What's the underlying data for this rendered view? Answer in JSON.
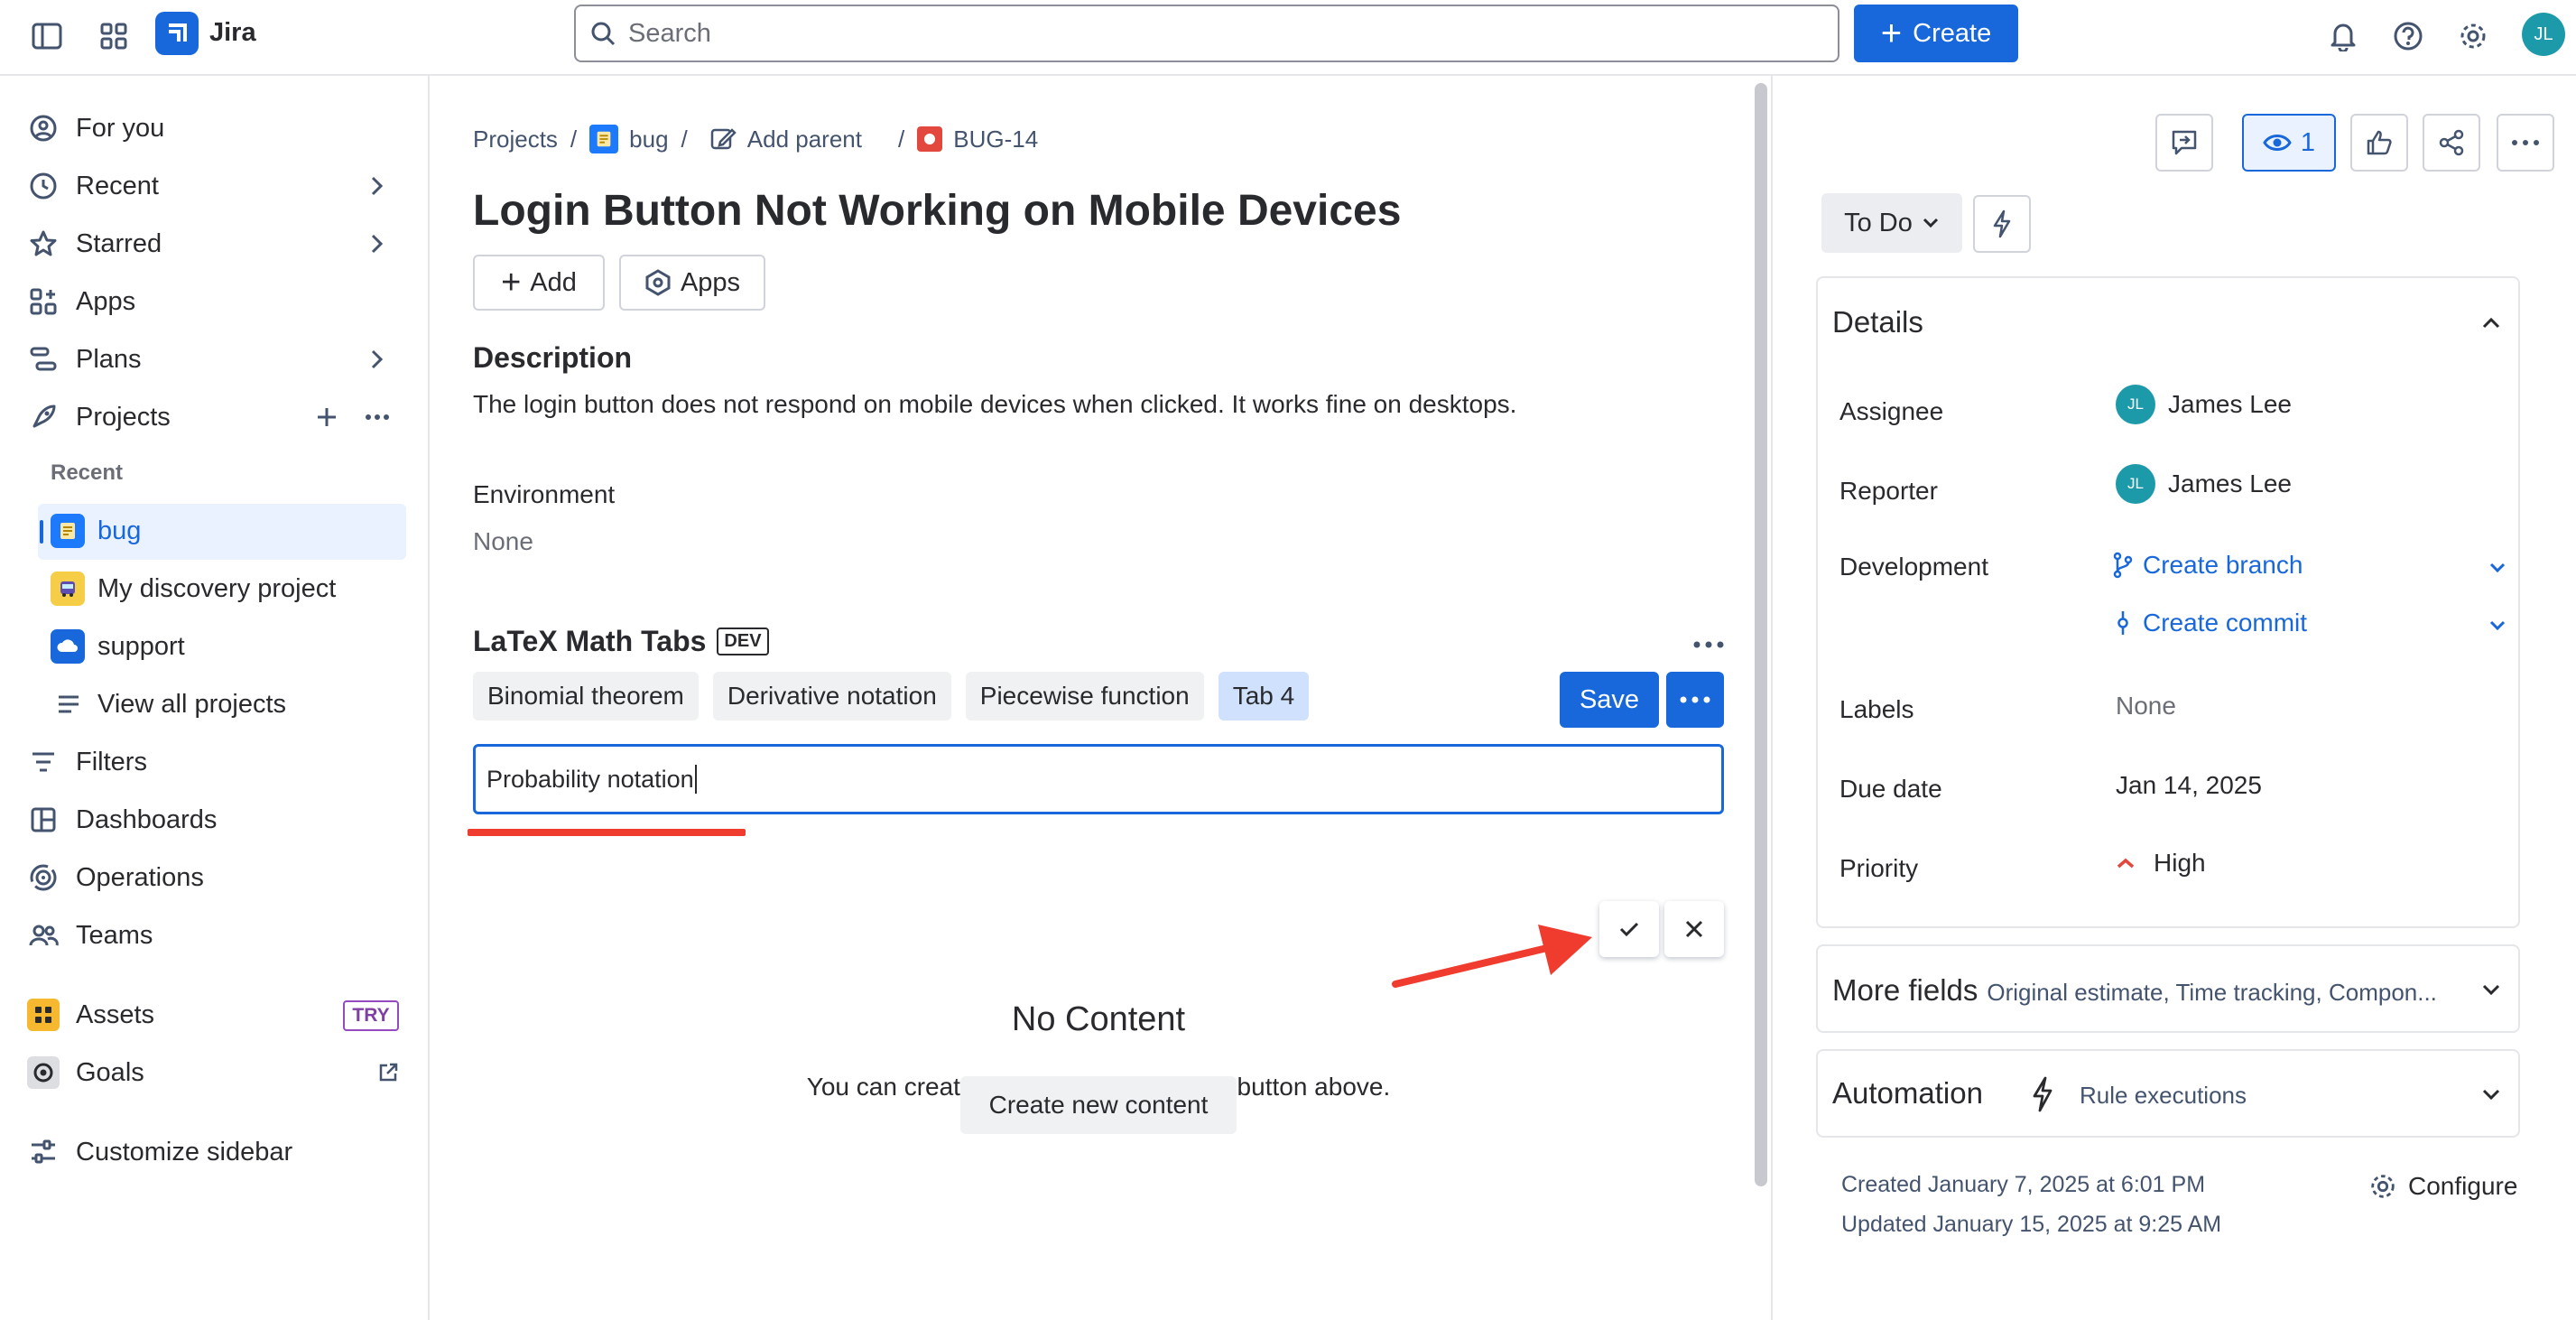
{
  "topbar": {
    "app_name": "Jira",
    "search_placeholder": "Search",
    "create_label": "Create",
    "avatar_initials": "JL"
  },
  "sidebar": {
    "items": [
      {
        "label": "For you",
        "icon": "user-circle-icon"
      },
      {
        "label": "Recent",
        "icon": "clock-icon"
      },
      {
        "label": "Starred",
        "icon": "star-icon"
      },
      {
        "label": "Apps",
        "icon": "apps-icon"
      },
      {
        "label": "Plans",
        "icon": "plans-icon"
      },
      {
        "label": "Projects",
        "icon": "rocket-icon"
      }
    ],
    "recent_heading": "Recent",
    "projects": [
      {
        "label": "bug",
        "icon": "notepad-icon",
        "color": "#1d7afc"
      },
      {
        "label": "My discovery project",
        "icon": "bus-icon",
        "color": "#f5cd47"
      },
      {
        "label": "support",
        "icon": "cloud-icon",
        "color": "#1868db"
      }
    ],
    "view_all": "View all projects",
    "bottom_items": [
      {
        "label": "Filters",
        "icon": "filter-icon"
      },
      {
        "label": "Dashboards",
        "icon": "dashboard-icon"
      },
      {
        "label": "Operations",
        "icon": "operations-icon"
      },
      {
        "label": "Teams",
        "icon": "teams-icon"
      }
    ],
    "assets": {
      "label": "Assets",
      "badge": "TRY"
    },
    "goals": {
      "label": "Goals"
    },
    "customize": "Customize sidebar"
  },
  "main": {
    "breadcrumb": {
      "projects": "Projects",
      "project": "bug",
      "add_parent": "Add parent",
      "issue_key": "BUG-14",
      "sep": "/"
    },
    "title": "Login Button Not Working on Mobile Devices",
    "add_label": "Add",
    "apps_label": "Apps",
    "description_heading": "Description",
    "description_text": "The login button does not respond on mobile devices when clicked. It works fine on desktops.",
    "environment_heading": "Environment",
    "environment_value": "None",
    "latex": {
      "title": "LaTeX Math Tabs",
      "badge": "DEV",
      "tabs": [
        "Binomial theorem",
        "Derivative notation",
        "Piecewise function",
        "Tab 4"
      ],
      "save_label": "Save",
      "input_value": "Probability notation",
      "no_content_title": "No Content",
      "no_content_text": "You can create content by clicking the button above.",
      "create_button": "Create new content"
    }
  },
  "right": {
    "watch_count": "1",
    "status": "To Do",
    "details_heading": "Details",
    "fields": {
      "assignee_label": "Assignee",
      "assignee": "James Lee",
      "reporter_label": "Reporter",
      "reporter": "James Lee",
      "avatar_initials": "JL",
      "development_label": "Development",
      "create_branch": "Create branch",
      "create_commit": "Create commit",
      "labels_label": "Labels",
      "labels_value": "None",
      "due_label": "Due date",
      "due_value": "Jan 14, 2025",
      "priority_label": "Priority",
      "priority_value": "High"
    },
    "more_fields": {
      "title": "More fields",
      "subtitle": "Original estimate, Time tracking, Compon..."
    },
    "automation": {
      "title": "Automation",
      "subtitle": "Rule executions"
    },
    "created": "Created January 7, 2025 at 6:01 PM",
    "updated": "Updated January 15, 2025 at 9:25 AM",
    "configure": "Configure"
  }
}
